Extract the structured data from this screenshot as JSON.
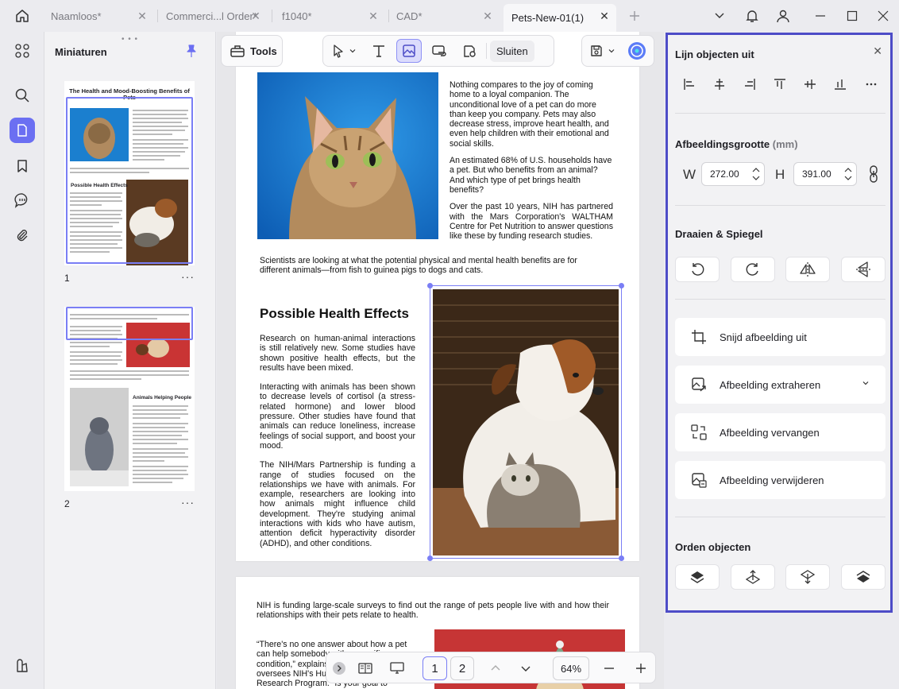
{
  "tabs": [
    {
      "label": "Naamloos*",
      "active": false
    },
    {
      "label": "Commerci...l Order*",
      "active": false
    },
    {
      "label": "f1040*",
      "active": false
    },
    {
      "label": "CAD*",
      "active": false
    },
    {
      "label": "Pets-New-01(1)",
      "active": true
    }
  ],
  "thumbnails": {
    "title": "Miniaturen",
    "pages": [
      {
        "number": "1",
        "more": "···"
      },
      {
        "number": "2",
        "more": "···"
      }
    ],
    "page1": {
      "title": "The Health and Mood-Boosting Benefits of Pets",
      "heading": "Possible Health Effects"
    },
    "page2": {
      "heading": "Animals Helping People"
    }
  },
  "toolbar": {
    "tools_label": "Tools",
    "close_label": "Sluiten"
  },
  "document": {
    "intro_p1": "Nothing compares to the joy of coming home to a loyal companion. The unconditional love of a pet can do more than keep you company. Pets may also decrease stress, improve heart health, and  even  help children  with  their emotional and social skills.",
    "intro_p2": "An estimated 68% of U.S. households have a pet. But who benefits from an animal? And which type of pet brings health benefits?",
    "intro_p3": "Over  the  past  10  years,  NIH  has partnered with the Mars Corporation's WALTHAM Centre for  Pet  Nutrition  to answer  questions  like these by funding research studies.",
    "scientists": "Scientists are looking at what the potential physical and mental health benefits are for different animals—from fish to guinea pigs to dogs and cats.",
    "heading": "Possible Health Effects",
    "effects_p1": "Research on human-animal interactions is still relatively new. Some studies have shown positive health effects, but the results have been mixed.",
    "effects_p2": "Interacting with animals has been shown to decrease levels of cortisol (a stress-related hormone) and lower blood pressure. Other studies have found that animals can reduce loneliness, increase feelings of social support, and boost your mood.",
    "effects_p3": "The NIH/Mars Partnership is funding a range of studies focused on the relationships we have with animals. For example, researchers are looking into how animals might influence child development. They're studying animal interactions with kids who have autism, attention deficit hyperactivity disorder (ADHD), and other conditions.",
    "page2_p1": "NIH is funding large-scale surveys to find out the range of pets people live with and how their relationships with their pets relate to health.",
    "page2_quote": "“There's no one answer about how a pet can help somebody with a specific condition,” explains Dr. Layla Esposito, who oversees NIH's Human-Animal Interaction Research Program. “Is your goal to increase"
  },
  "bottom_bar": {
    "page_current": "1",
    "page_next": "2",
    "zoom": "64%"
  },
  "right_panel": {
    "align_title": "Lijn objecten uit",
    "size_title": "Afbeeldingsgrootte",
    "size_unit": "(mm)",
    "width_label": "W",
    "width_value": "272.00",
    "height_label": "H",
    "height_value": "391.00",
    "rotate_title": "Draaien & Spiegel",
    "crop_label": "Snijd afbeelding uit",
    "extract_label": "Afbeelding extraheren",
    "replace_label": "Afbeelding vervangen",
    "delete_label": "Afbeelding verwijderen",
    "order_title": "Orden objecten"
  },
  "colors": {
    "accent": "#6b6ff2",
    "panel_border": "#4d4cc7",
    "selection": "#7a7ef5"
  }
}
